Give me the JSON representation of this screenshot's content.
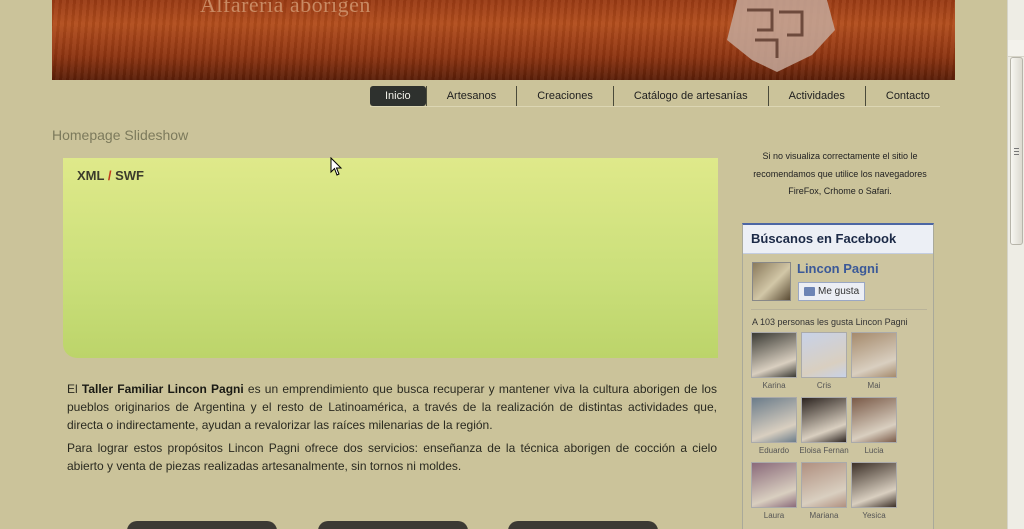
{
  "header": {
    "banner_title": "Alfarería aborigen"
  },
  "nav": {
    "items": [
      "Inicio",
      "Artesanos",
      "Creaciones",
      "Catálogo de artesanías",
      "Actividades",
      "Contacto"
    ],
    "active": "Inicio"
  },
  "slideshow": {
    "title": "Homepage Slideshow",
    "link_xml": "XML",
    "separator": "/",
    "link_swf": "SWF"
  },
  "body": {
    "p1_intro": "El ",
    "p1_bold": "Taller Familiar Lincon Pagni",
    "p1_rest": " es un emprendimiento que busca recuperar y mantener viva la cultura aborigen de los pueblos originarios de Argentina y el resto de Latinoamérica, a través de la realización de distintas actividades que, directa o indirectamente, ayudan a revalorizar las raíces milenarias de la región.",
    "p2": "Para lograr estos propósitos Lincon Pagni ofrece dos servicios: enseñanza de la técnica aborigen de cocción a cielo abierto y venta de piezas realizadas artesanalmente, sin tornos ni moldes."
  },
  "sidebar": {
    "notice": "Si no  visualiza correctamente el sitio le recomendamos que utilice los navegadores FireFox, Crhome o Safari.",
    "facebook": {
      "title": "Búscanos en Facebook",
      "page_name": "Lincon Pagni",
      "like_label": "Me gusta",
      "count_text": "A 103 personas les gusta Lincon Pagni",
      "fans": [
        {
          "name": "Karina",
          "color": "#3a3a34"
        },
        {
          "name": "Cris",
          "color": "#c8d2e8"
        },
        {
          "name": "Mai",
          "color": "#a58a6c"
        },
        {
          "name": "Eduardo",
          "color": "#6b7c8a"
        },
        {
          "name": "Eloisa Fernan",
          "color": "#2c2420"
        },
        {
          "name": "Lucia",
          "color": "#7a5a48"
        },
        {
          "name": "Laura",
          "color": "#8a6a7a"
        },
        {
          "name": "Mariana",
          "color": "#b09080"
        },
        {
          "name": "Yesica",
          "color": "#3c3028"
        }
      ]
    }
  },
  "colors": {
    "background": "#cbc39a",
    "slideshow": "#d8e684",
    "facebook_blue": "#3b5998",
    "banner": "#9a3b14"
  }
}
